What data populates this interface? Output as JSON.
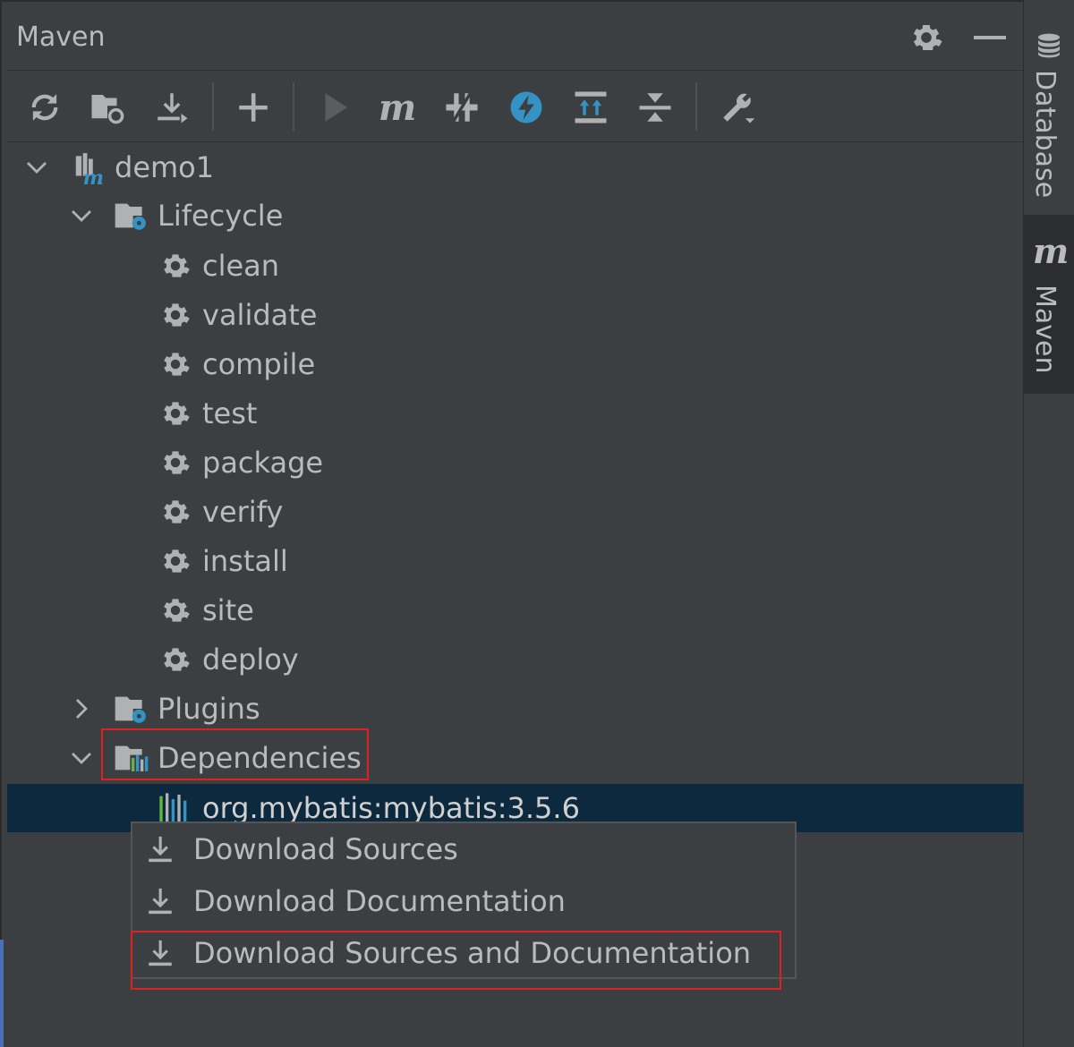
{
  "window": {
    "title": "Maven"
  },
  "toolbar": {
    "buttons": [
      "reload-icon",
      "folder-sync-icon",
      "download-icon",
      "add-icon",
      "run-icon",
      "maven-m-icon",
      "toggle-skip-tests-icon",
      "offline-lightning-icon",
      "show-dependencies-icon",
      "collapse-all-icon",
      "settings-wrench-icon"
    ]
  },
  "stripe": {
    "database_label": "Database",
    "maven_label": "Maven",
    "maven_glyph": "m"
  },
  "tree": {
    "project": "demo1",
    "lifecycle_label": "Lifecycle",
    "lifecycle": [
      "clean",
      "validate",
      "compile",
      "test",
      "package",
      "verify",
      "install",
      "site",
      "deploy"
    ],
    "plugins_label": "Plugins",
    "dependencies_label": "Dependencies",
    "dependency": "org.mybatis:mybatis:3.5.6"
  },
  "context_menu": {
    "items": [
      "Download Sources",
      "Download Documentation",
      "Download Sources and Documentation"
    ]
  },
  "colors": {
    "background": "#3c3f41",
    "selection": "#0d293e",
    "highlight_box": "#e02020",
    "accent_blue": "#3592c4"
  }
}
